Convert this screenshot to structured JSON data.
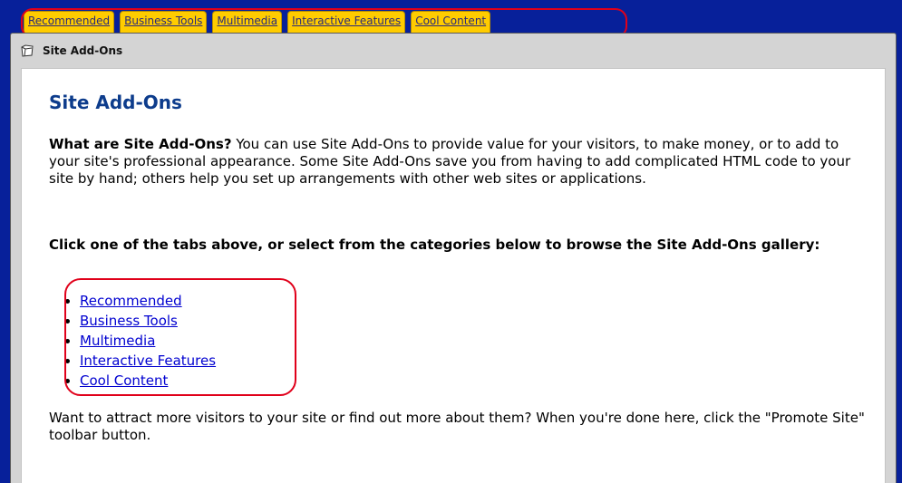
{
  "tabs": [
    {
      "label": "Recommended"
    },
    {
      "label": "Business Tools"
    },
    {
      "label": "Multimedia"
    },
    {
      "label": "Interactive Features"
    },
    {
      "label": "Cool Content"
    }
  ],
  "panel": {
    "header_title": "Site Add-Ons",
    "header_icon": "folder-icon"
  },
  "content": {
    "title": "Site Add-Ons",
    "intro_bold": "What are Site Add-Ons?",
    "intro_text": " You can use Site Add-Ons to provide value for your visitors, to make money, or to add to your site's professional appearance. Some Site Add-Ons save you from having to add complicated HTML code to your site by hand; others help you set up arrangements with other web sites or applications.",
    "prompt": "Click one of the tabs above, or select from the categories below to browse the Site Add-Ons gallery:",
    "categories": [
      {
        "label": "Recommended"
      },
      {
        "label": "Business Tools"
      },
      {
        "label": "Multimedia"
      },
      {
        "label": "Interactive Features"
      },
      {
        "label": "Cool Content"
      }
    ],
    "outro": "Want to attract more visitors to your site or find out more about them? When you're done here, click the \"Promote Site\" toolbar button."
  },
  "colors": {
    "frame_background": "#07209a",
    "tab_background": "#ffcc00",
    "title_color": "#0d3c8c",
    "link_color": "#0000d0",
    "highlight_outline": "#e0001a"
  }
}
